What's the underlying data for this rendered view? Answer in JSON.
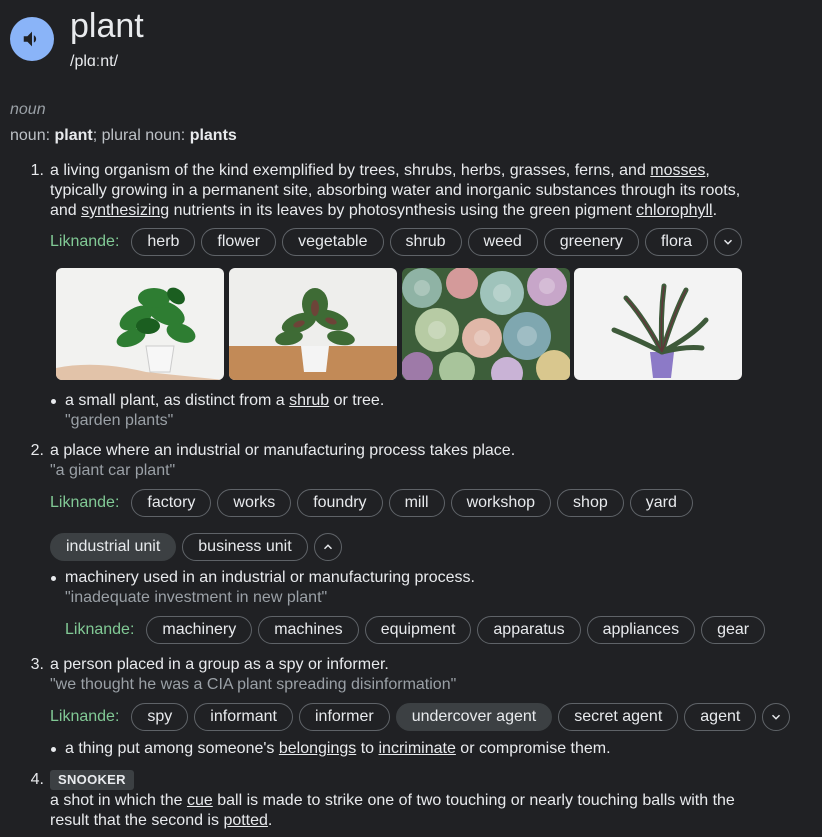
{
  "headword": "plant",
  "phonetic": "/plɑːnt/",
  "part_of_speech": "noun",
  "forms": {
    "noun_label": "noun:",
    "noun_value": "plant",
    "plural_label": "plural noun:",
    "plural_value": "plants"
  },
  "synonyms_label": "Liknande:",
  "senses": [
    {
      "number": "1.",
      "def_parts": [
        "a living organism of the kind exemplified by trees, shrubs, herbs, grasses, ferns, and ",
        "mosses",
        ","
      ],
      "def_line2_parts": [
        "typically growing in a permanent site, absorbing water and inorganic substances through its roots,"
      ],
      "def_line3_parts": [
        "and ",
        "synthesizing",
        " nutrients in its leaves by photosynthesis using the green pigment ",
        "chlorophyll",
        "."
      ],
      "synonyms": [
        "herb",
        "flower",
        "vegetable",
        "shrub",
        "weed",
        "greenery",
        "flora"
      ],
      "images": [
        "plant-photo-1",
        "plant-photo-2",
        "plant-photo-3",
        "plant-photo-4"
      ],
      "sub": {
        "def_parts": [
          "a small plant, as distinct from a ",
          "shrub",
          " or tree."
        ],
        "example": "\"garden plants\""
      }
    },
    {
      "number": "2.",
      "def": "a place where an industrial or manufacturing process takes place.",
      "example": "\"a giant car plant\"",
      "synonyms": [
        "factory",
        "works",
        "foundry",
        "mill",
        "workshop",
        "shop",
        "yard"
      ],
      "synonyms_row2": [
        "industrial unit",
        "business unit"
      ],
      "sub": {
        "def": "machinery used in an industrial or manufacturing process.",
        "example": "\"inadequate investment in new plant\"",
        "synonyms": [
          "machinery",
          "machines",
          "equipment",
          "apparatus",
          "appliances",
          "gear"
        ]
      }
    },
    {
      "number": "3.",
      "def": "a person placed in a group as a spy or informer.",
      "example": "\"we thought he was a CIA plant spreading disinformation\"",
      "synonyms": [
        "spy",
        "informant",
        "informer",
        "undercover agent",
        "secret agent",
        "agent"
      ],
      "sub": {
        "def_parts": [
          "a thing put among someone's ",
          "belongings",
          " to ",
          "incriminate",
          " or compromise them."
        ]
      }
    },
    {
      "number": "4.",
      "tag": "SNOOKER",
      "def_line1_parts": [
        "a shot in which the ",
        "cue",
        " ball is made to strike one of two touching or nearly touching balls with the"
      ],
      "def_line2_parts": [
        "result that the second is ",
        "potted",
        "."
      ]
    }
  ],
  "icons": {
    "speaker": "speaker-icon",
    "expand": "chevron-down-icon",
    "collapse": "chevron-up-icon"
  },
  "colors": {
    "background": "#202124",
    "speaker": "#8ab4f8",
    "synonym_label": "#81c995",
    "chip_border": "#5f6368"
  }
}
